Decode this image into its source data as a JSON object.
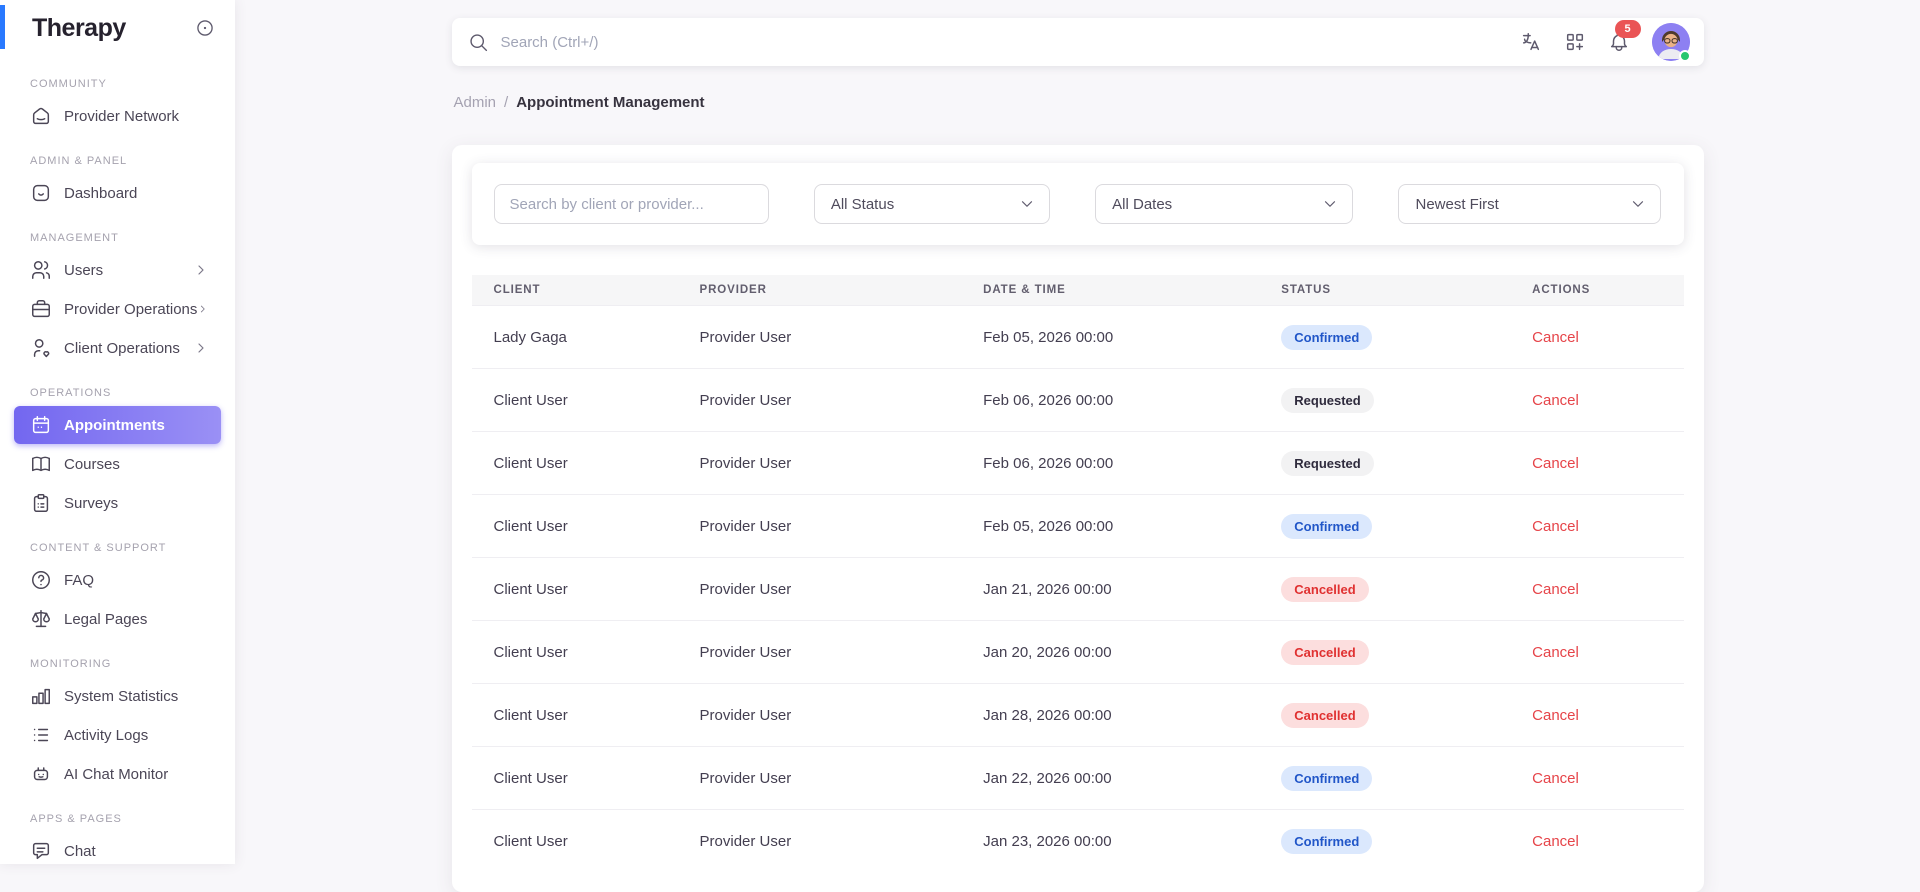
{
  "app": {
    "logo": "Therapy"
  },
  "header": {
    "search_placeholder": "Search (Ctrl+/)",
    "notification_count": "5",
    "icons": [
      "language-icon",
      "apps-grid-icon",
      "bell-icon",
      "user-avatar"
    ]
  },
  "breadcrumb": {
    "section": "Admin",
    "separator": "/",
    "current": "Appointment Management"
  },
  "sidebar": {
    "sections": [
      {
        "header": "COMMUNITY",
        "items": [
          {
            "label": "Provider Network",
            "icon": "home"
          }
        ]
      },
      {
        "header": "ADMIN & PANEL",
        "items": [
          {
            "label": "Dashboard",
            "icon": "dashboard"
          }
        ]
      },
      {
        "header": "MANAGEMENT",
        "items": [
          {
            "label": "Users",
            "icon": "users",
            "chevron": true
          },
          {
            "label": "Provider Operations",
            "icon": "briefcase",
            "chevron": true
          },
          {
            "label": "Client Operations",
            "icon": "user-heart",
            "chevron": true
          }
        ]
      },
      {
        "header": "OPERATIONS",
        "items": [
          {
            "label": "Appointments",
            "icon": "calendar",
            "active": true
          },
          {
            "label": "Courses",
            "icon": "book"
          },
          {
            "label": "Surveys",
            "icon": "clipboard"
          }
        ]
      },
      {
        "header": "CONTENT & SUPPORT",
        "items": [
          {
            "label": "FAQ",
            "icon": "help-circle"
          },
          {
            "label": "Legal Pages",
            "icon": "scale"
          }
        ]
      },
      {
        "header": "MONITORING",
        "items": [
          {
            "label": "System Statistics",
            "icon": "chart-bar"
          },
          {
            "label": "Activity Logs",
            "icon": "list"
          },
          {
            "label": "AI Chat Monitor",
            "icon": "robot"
          }
        ]
      },
      {
        "header": "APPS & PAGES",
        "items": [
          {
            "label": "Chat",
            "icon": "message"
          }
        ]
      }
    ]
  },
  "filters": {
    "search_placeholder": "Search by client or provider...",
    "status_dropdown": "All Status",
    "dates_dropdown": "All Dates",
    "sort_dropdown": "Newest First"
  },
  "table": {
    "columns": [
      "CLIENT",
      "PROVIDER",
      "DATE & TIME",
      "STATUS",
      "ACTIONS"
    ],
    "action_label": "Cancel",
    "rows": [
      {
        "client": "Lady Gaga",
        "provider": "Provider User",
        "datetime": "Feb 05, 2026 00:00",
        "status": "Confirmed",
        "status_type": "confirmed"
      },
      {
        "client": "Client User",
        "provider": "Provider User",
        "datetime": "Feb 06, 2026 00:00",
        "status": "Requested",
        "status_type": "requested"
      },
      {
        "client": "Client User",
        "provider": "Provider User",
        "datetime": "Feb 06, 2026 00:00",
        "status": "Requested",
        "status_type": "requested"
      },
      {
        "client": "Client User",
        "provider": "Provider User",
        "datetime": "Feb 05, 2026 00:00",
        "status": "Confirmed",
        "status_type": "confirmed"
      },
      {
        "client": "Client User",
        "provider": "Provider User",
        "datetime": "Jan 21, 2026 00:00",
        "status": "Cancelled",
        "status_type": "cancelled"
      },
      {
        "client": "Client User",
        "provider": "Provider User",
        "datetime": "Jan 20, 2026 00:00",
        "status": "Cancelled",
        "status_type": "cancelled"
      },
      {
        "client": "Client User",
        "provider": "Provider User",
        "datetime": "Jan 28, 2026 00:00",
        "status": "Cancelled",
        "status_type": "cancelled"
      },
      {
        "client": "Client User",
        "provider": "Provider User",
        "datetime": "Jan 22, 2026 00:00",
        "status": "Confirmed",
        "status_type": "confirmed"
      },
      {
        "client": "Client User",
        "provider": "Provider User",
        "datetime": "Jan 23, 2026 00:00",
        "status": "Confirmed",
        "status_type": "confirmed"
      }
    ]
  },
  "colors": {
    "accent": "#7367f0",
    "brand_bar": "#2979ff",
    "notification_badge": "#ea5455",
    "online_dot": "#28c76f",
    "status_confirmed_bg": "#dbe8fd",
    "status_confirmed_text": "#2156c8",
    "status_requested_bg": "#f2f2f3",
    "status_requested_text": "#2f2b3d",
    "status_cancelled_bg": "#fcdede",
    "status_cancelled_text": "#e03131",
    "cancel_link": "#e64449"
  }
}
